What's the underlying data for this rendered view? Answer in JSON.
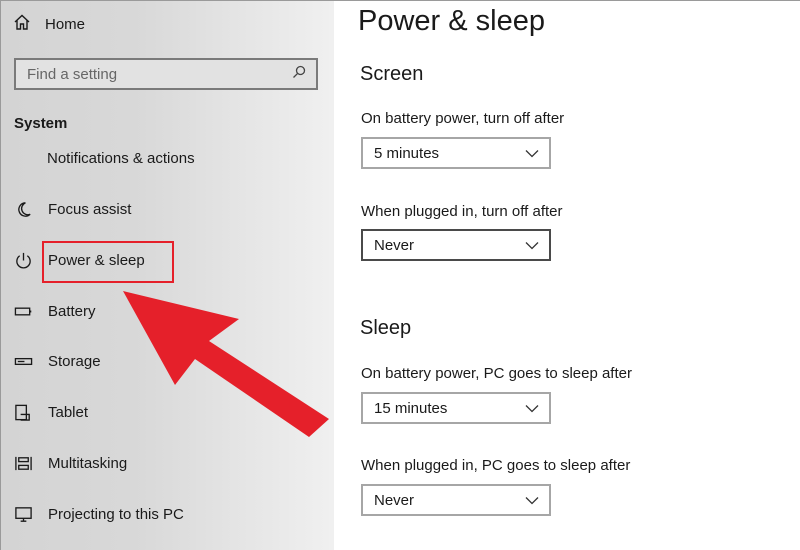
{
  "sidebar": {
    "home_label": "Home",
    "search_placeholder": "Find a setting",
    "section_title": "System",
    "clipped_item_label": "Notifications & actions",
    "items": [
      {
        "label": "Focus assist",
        "icon": "moon-icon"
      },
      {
        "label": "Power & sleep",
        "icon": "power-icon",
        "selected": true
      },
      {
        "label": "Battery",
        "icon": "battery-icon"
      },
      {
        "label": "Storage",
        "icon": "storage-icon"
      },
      {
        "label": "Tablet",
        "icon": "tablet-icon"
      },
      {
        "label": "Multitasking",
        "icon": "multitasking-icon"
      },
      {
        "label": "Projecting to this PC",
        "icon": "projecting-icon"
      }
    ]
  },
  "annotation": {
    "highlight_color": "#e5202a",
    "arrow_color": "#e5202a",
    "arrow_target": "Power & sleep"
  },
  "main": {
    "title": "Power & sleep",
    "screen": {
      "heading": "Screen",
      "battery_label": "On battery power, turn off after",
      "battery_value": "5 minutes",
      "plugged_label": "When plugged in, turn off after",
      "plugged_value": "Never"
    },
    "sleep": {
      "heading": "Sleep",
      "battery_label": "On battery power, PC goes to sleep after",
      "battery_value": "15 minutes",
      "plugged_label": "When plugged in, PC goes to sleep after",
      "plugged_value": "Never"
    }
  },
  "colors": {
    "sidebar_bg": "#d8d8d8",
    "text": "#1a1a1a",
    "dropdown_border": "#a6a6a6"
  }
}
